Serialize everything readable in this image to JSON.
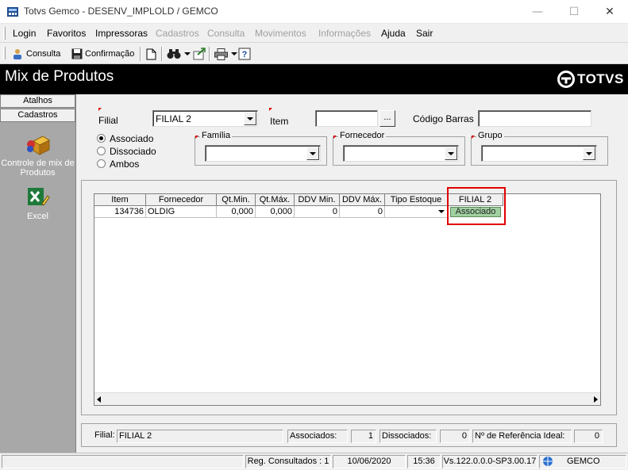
{
  "window": {
    "title": "Totvs Gemco - DESENV_IMPLOLD / GEMCO",
    "minimize": "—",
    "maximize": "☐",
    "close": "✕"
  },
  "menu": {
    "items": [
      "Login",
      "Favoritos",
      "Impressoras",
      "Cadastros",
      "Consulta",
      "Movimentos",
      "Informações",
      "Ajuda",
      "Sair"
    ]
  },
  "toolbar": {
    "consulta": "Consulta",
    "confirmacao": "Confirmação"
  },
  "header": {
    "title": "Mix de Produtos",
    "logo": "TOTVS"
  },
  "sidebar": {
    "tab_atalhos": "Atalhos",
    "tab_cadastros": "Cadastros",
    "item_controle": "Controle de mix de Produtos",
    "item_excel": "Excel"
  },
  "filters": {
    "filial_label": "Filial",
    "filial_value": "FILIAL 2",
    "item_label": "Item",
    "item_value": "",
    "item_lookup": "...",
    "codigo_barras_label": "Código Barras",
    "codigo_barras_value": "",
    "radio_associado": "Associado",
    "radio_dissociado": "Dissociado",
    "radio_ambos": "Ambos",
    "familia_label": "Família",
    "fornecedor_label": "Fornecedor",
    "grupo_label": "Grupo"
  },
  "grid": {
    "columns": [
      "Item",
      "Fornecedor",
      "Qt.Min.",
      "Qt.Máx.",
      "DDV Min.",
      "DDV Máx.",
      "Tipo Estoque",
      "FILIAL 2"
    ],
    "rows": [
      {
        "item": "134736",
        "fornecedor": "OLDIG",
        "qt_min": "0,000",
        "qt_max": "0,000",
        "ddv_min": "0",
        "ddv_max": "0",
        "tipo_estoque": "",
        "filial_2": "Associado"
      }
    ]
  },
  "summary": {
    "filial_label": "Filial:",
    "filial_value": "FILIAL 2",
    "associados_label": "Associados:",
    "associados_value": "1",
    "dissociados_label": "Dissociados:",
    "dissociados_value": "0",
    "referencia_label": "Nº de Referência Ideal:",
    "referencia_value": "0"
  },
  "status": {
    "registros": "Reg. Consultados : 1",
    "date": "10/06/2020",
    "time": "15:36",
    "version": "Vs.122.0.0.0-SP3.00.17",
    "company": "GEMCO"
  },
  "colors": {
    "header_bg": "#000000",
    "highlight": "#e00000",
    "associado_chip": "#a0d0a0"
  }
}
